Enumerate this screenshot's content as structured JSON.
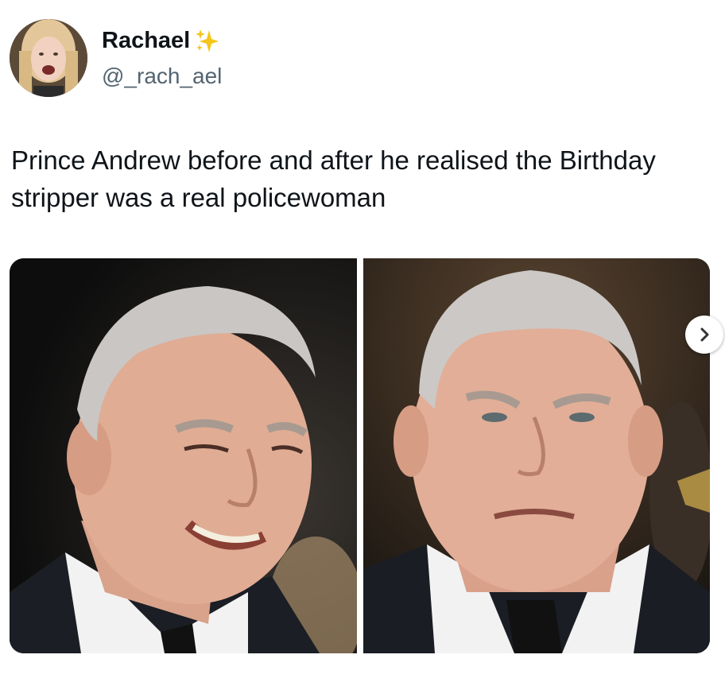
{
  "author": {
    "display_name": "Rachael",
    "handle": "@_rach_ael",
    "badge_icon": "sparkles-icon",
    "avatar_icon": "avatar-photo"
  },
  "tweet": {
    "text": "Prince Andrew before and after he realised the Birthday stripper was a real policewoman"
  },
  "media": {
    "images": [
      {
        "name": "before-photo",
        "description_icon": "smiling-man-photo"
      },
      {
        "name": "after-photo",
        "description_icon": "frowning-man-photo"
      }
    ],
    "next_icon": "chevron-right-icon"
  },
  "colors": {
    "text": "#0f1419",
    "secondary_text": "#536471",
    "sparkle": "#f5c518",
    "background": "#ffffff"
  }
}
